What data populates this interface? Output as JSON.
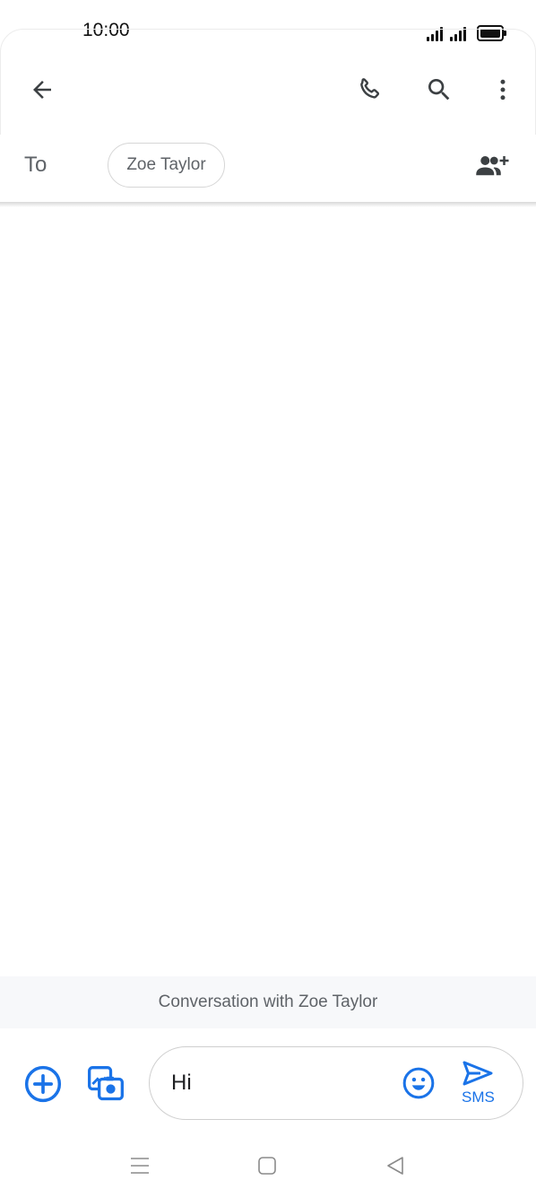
{
  "status_bar": {
    "time": "10:00"
  },
  "header": {
    "back_icon": "arrow-back-icon",
    "call_icon": "phone-icon",
    "search_icon": "search-icon",
    "menu_icon": "more-vert-icon"
  },
  "recipients": {
    "to_label": "To",
    "chips": [
      "Zoe Taylor"
    ],
    "add_icon": "add-people-icon"
  },
  "conversation": {
    "banner": "Conversation with Zoe Taylor"
  },
  "composer": {
    "message_text": "Hi",
    "send_label": "SMS",
    "accent_color": "#1a73e8"
  }
}
